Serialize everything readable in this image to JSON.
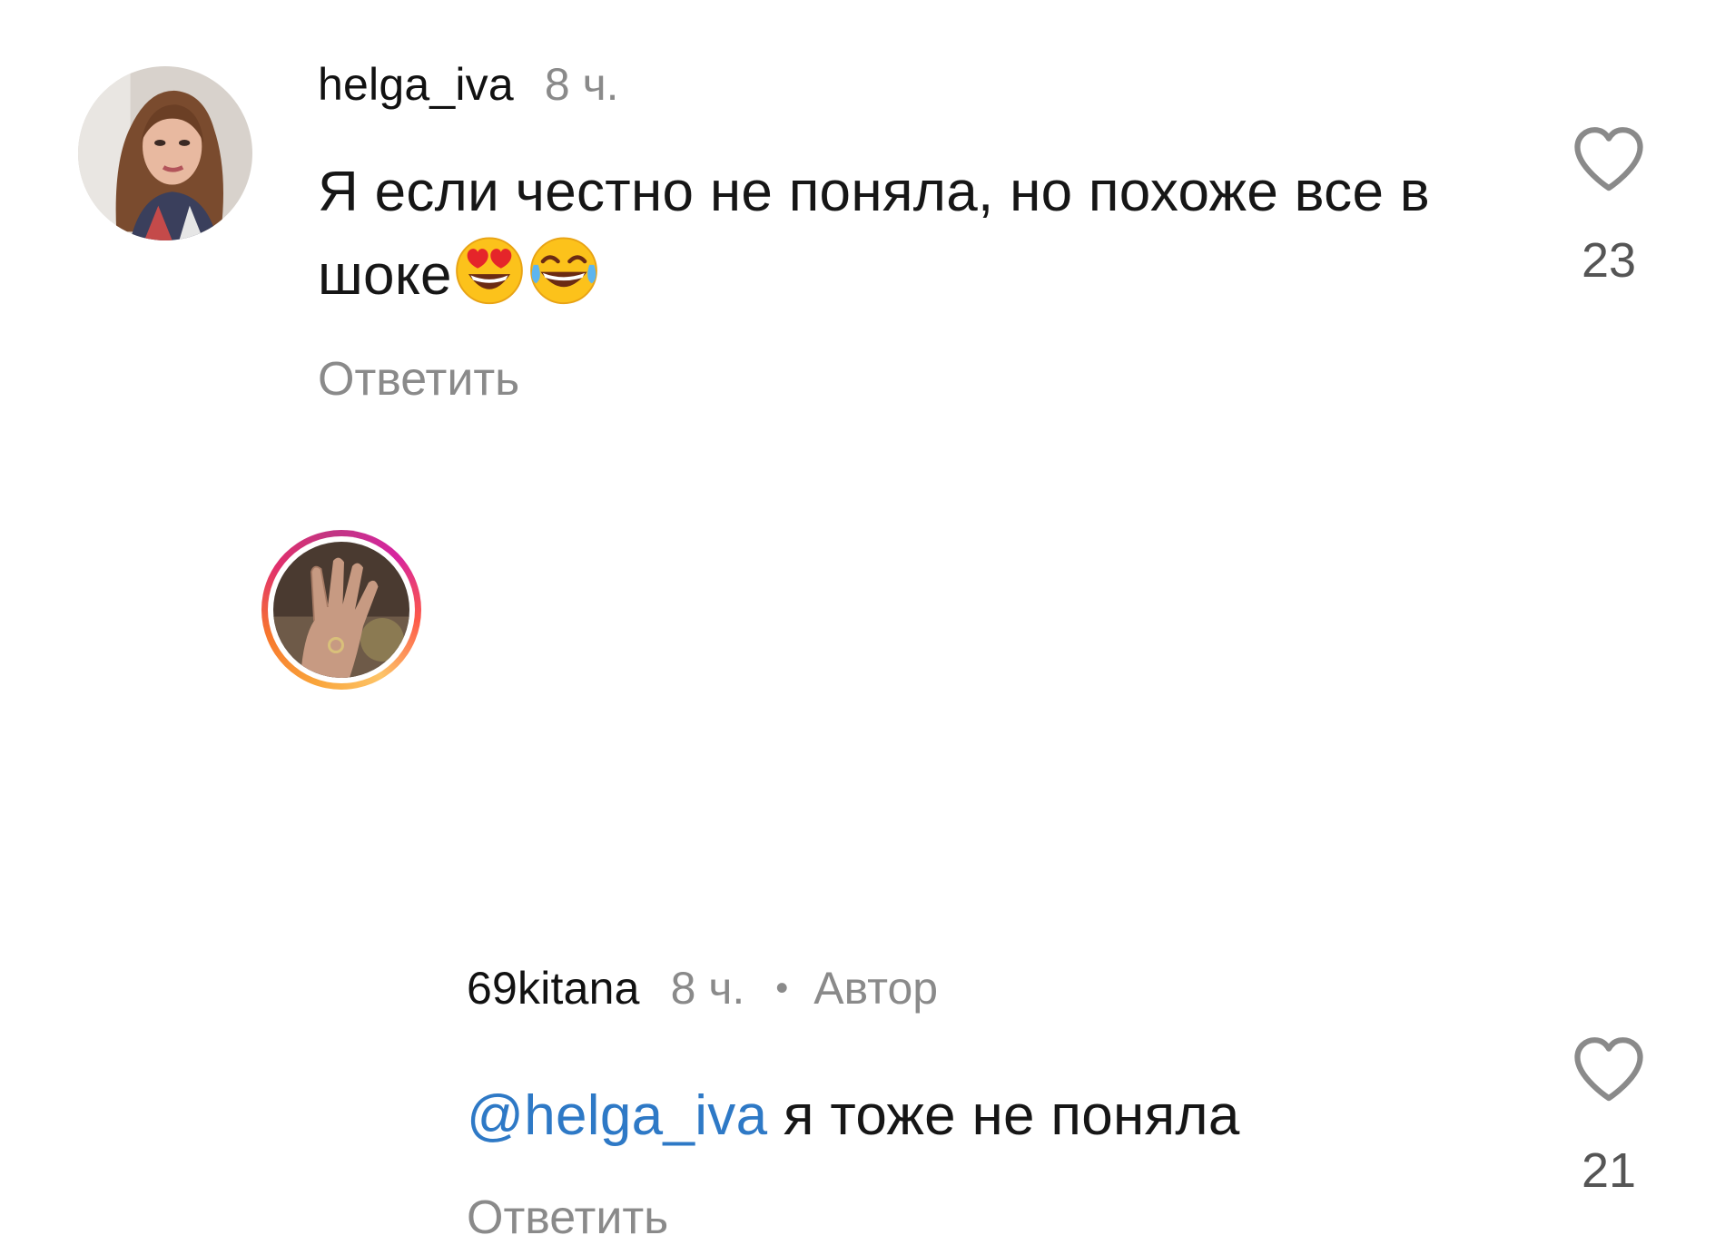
{
  "comments": [
    {
      "username": "helga_iva",
      "time": "8 ч.",
      "text": "Я если честно не поняла, но похоже все в шоке",
      "emojis": [
        "heart-eyes-emoji",
        "tears-of-joy-emoji"
      ],
      "reply_label": "Ответить",
      "likes": "23",
      "icons": {
        "like": "heart-outline-icon"
      }
    },
    {
      "username": "69kitana",
      "time": "8 ч.",
      "separator": "•",
      "badge": "Автор",
      "mention": "@helga_iva",
      "text": " я тоже не поняла",
      "reply_label": "Ответить",
      "likes": "21",
      "icons": {
        "like": "heart-outline-icon"
      }
    }
  ],
  "colors": {
    "mention": "#2e79c6",
    "secondary_text": "#8a8a8a",
    "story_ring": [
      "#f9a43a",
      "#e1306c",
      "#c13584"
    ]
  }
}
